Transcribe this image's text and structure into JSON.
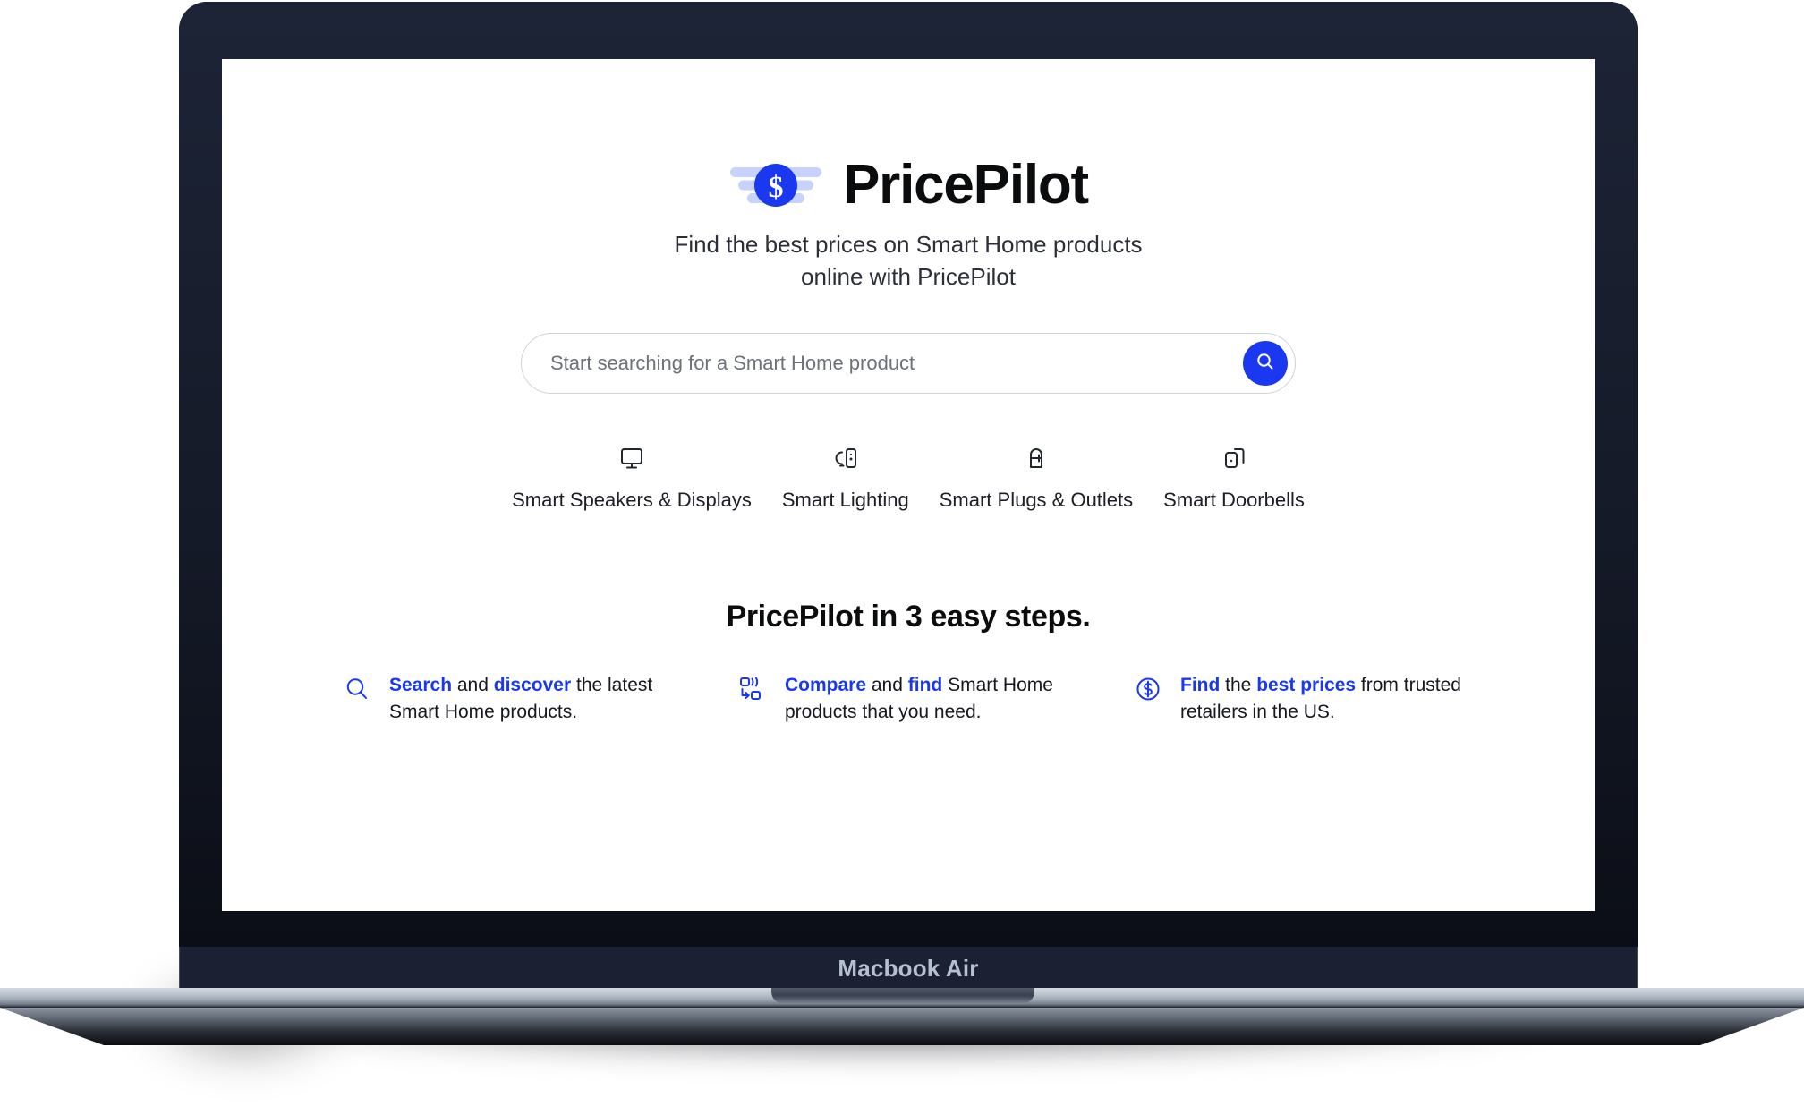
{
  "device": {
    "model_label": "Macbook Air"
  },
  "brand": {
    "name": "PricePilot",
    "logo_icon": "winged-dollar-logo",
    "accent_color": "#1A38EF",
    "logo_wing_color": "#C7D2FE"
  },
  "hero": {
    "tagline_line1": "Find the best prices on Smart Home products",
    "tagline_line2": "online with PricePilot"
  },
  "search": {
    "placeholder": "Start searching for a Smart Home product",
    "value": "",
    "button_icon": "search-icon",
    "button_label": "Search"
  },
  "categories": [
    {
      "label": "Smart Speakers & Displays",
      "icon": "monitor-display-icon"
    },
    {
      "label": "Smart Lighting",
      "icon": "smart-light-device-icon"
    },
    {
      "label": "Smart Plugs & Outlets",
      "icon": "plug-outlet-icon"
    },
    {
      "label": "Smart Doorbells",
      "icon": "doorbell-icon"
    }
  ],
  "steps_section": {
    "title": "PricePilot in 3 easy steps.",
    "steps": [
      {
        "icon": "search-icon",
        "lead": "Search",
        "mid": " and ",
        "lead2": "discover",
        "tail": " the latest Smart Home products."
      },
      {
        "icon": "compare-icon",
        "lead": "Compare",
        "mid": " and ",
        "lead2": "find",
        "tail": " Smart Home products that you need."
      },
      {
        "icon": "dollar-circle-icon",
        "lead": "Find",
        "mid": " the ",
        "lead2": "best prices",
        "tail": " from trusted retailers in the US."
      }
    ]
  }
}
